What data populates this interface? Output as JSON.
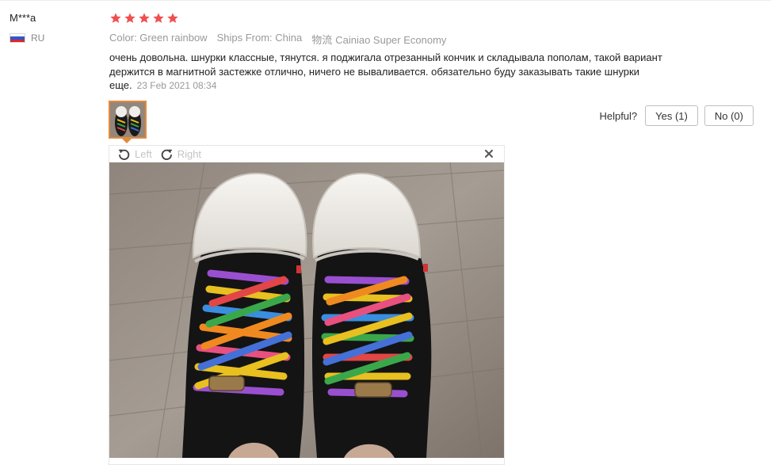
{
  "review": {
    "buyer_name": "M***a",
    "country_code": "RU",
    "flag_colors": [
      "#ffffff",
      "#2f57c8",
      "#d9262c"
    ],
    "star_count": 5,
    "rating_color": "#f04f4f",
    "meta": {
      "color": "Color: Green rainbow",
      "ships_from": "Ships From: China",
      "logistics_label": "物流",
      "logistics_value": "Cainiao Super Economy"
    },
    "text": "очень довольна. шнурки классные, тянутся. я поджигала отрезанный кончик и складывала пополам, такой вариант держится в магнитной застежке отлично, ничего не вываливается. обязательно буду заказывать такие шнурки еще.",
    "date": "23 Feb 2021 08:34"
  },
  "helpful": {
    "label": "Helpful?",
    "yes_label": "Yes (1)",
    "no_label": "No (0)"
  },
  "viewer": {
    "rotate_left_label": "Left",
    "rotate_right_label": "Right",
    "icons": {
      "rotate_left": "rotate-left-icon",
      "rotate_right": "rotate-right-icon",
      "close": "close-icon"
    }
  },
  "colors": {
    "accent": "#e5893c"
  }
}
